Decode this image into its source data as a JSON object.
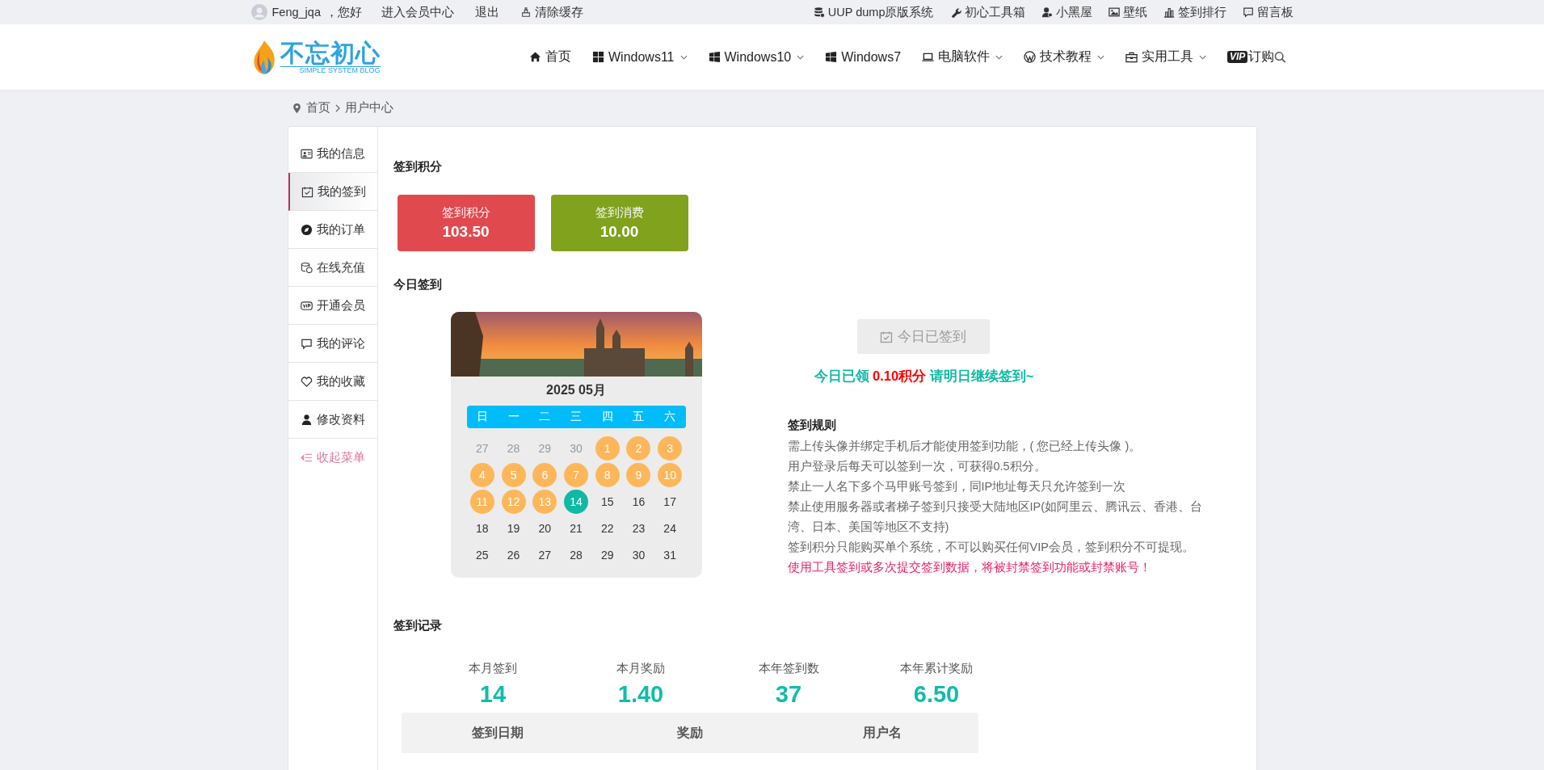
{
  "top_bar": {
    "user": {
      "name": "Feng_jqa",
      "greeting": "，您好"
    },
    "left_links": [
      "进入会员中心",
      "退出",
      "清除缓存"
    ],
    "right_links": [
      "UUP dump原版系统",
      "初心工具箱",
      "小黑屋",
      "壁纸",
      "签到排行",
      "留言板"
    ]
  },
  "header": {
    "logo": {
      "title": "不忘初心",
      "subtitle": "SIMPLE SYSTEM BLOG"
    },
    "nav": [
      {
        "label": "首页",
        "has_menu": false
      },
      {
        "label": "Windows11",
        "has_menu": true
      },
      {
        "label": "Windows10",
        "has_menu": true
      },
      {
        "label": "Windows7",
        "has_menu": false
      },
      {
        "label": "电脑软件",
        "has_menu": true
      },
      {
        "label": "技术教程",
        "has_menu": true
      },
      {
        "label": "实用工具",
        "has_menu": true
      },
      {
        "label": "订购",
        "has_menu": false
      }
    ],
    "vip_badge": "VIP"
  },
  "breadcrumb": [
    "首页",
    "用户中心"
  ],
  "sidebar": {
    "items": [
      {
        "label": "我的信息",
        "selected": false
      },
      {
        "label": "我的签到",
        "selected": true
      },
      {
        "label": "我的订单",
        "selected": false
      },
      {
        "label": "在线充值",
        "selected": false
      },
      {
        "label": "开通会员",
        "selected": false
      },
      {
        "label": "我的评论",
        "selected": false
      },
      {
        "label": "我的收藏",
        "selected": false
      },
      {
        "label": "修改资料",
        "selected": false
      }
    ],
    "collapse": "收起菜单"
  },
  "points": {
    "title": "签到积分",
    "cards": [
      {
        "label": "签到积分",
        "value": "103.50",
        "color": "#e04a4f"
      },
      {
        "label": "签到消费",
        "value": "10.00",
        "color": "#80a21d"
      }
    ]
  },
  "today": {
    "title": "今日签到",
    "calendar": {
      "month": "2025 05月",
      "weekdays": [
        "日",
        "一",
        "二",
        "三",
        "四",
        "五",
        "六"
      ],
      "days": [
        {
          "day": "27",
          "kind": "other"
        },
        {
          "day": "28",
          "kind": "other"
        },
        {
          "day": "29",
          "kind": "other"
        },
        {
          "day": "30",
          "kind": "other"
        },
        {
          "day": "1",
          "kind": "signed"
        },
        {
          "day": "2",
          "kind": "signed"
        },
        {
          "day": "3",
          "kind": "signed"
        },
        {
          "day": "4",
          "kind": "signed"
        },
        {
          "day": "5",
          "kind": "signed"
        },
        {
          "day": "6",
          "kind": "signed"
        },
        {
          "day": "7",
          "kind": "signed"
        },
        {
          "day": "8",
          "kind": "signed"
        },
        {
          "day": "9",
          "kind": "signed"
        },
        {
          "day": "10",
          "kind": "signed"
        },
        {
          "day": "11",
          "kind": "signed"
        },
        {
          "day": "12",
          "kind": "signed"
        },
        {
          "day": "13",
          "kind": "signed"
        },
        {
          "day": "14",
          "kind": "today"
        },
        {
          "day": "15",
          "kind": "normal"
        },
        {
          "day": "16",
          "kind": "normal"
        },
        {
          "day": "17",
          "kind": "normal"
        },
        {
          "day": "18",
          "kind": "normal"
        },
        {
          "day": "19",
          "kind": "normal"
        },
        {
          "day": "20",
          "kind": "normal"
        },
        {
          "day": "21",
          "kind": "normal"
        },
        {
          "day": "22",
          "kind": "normal"
        },
        {
          "day": "23",
          "kind": "normal"
        },
        {
          "day": "24",
          "kind": "normal"
        },
        {
          "day": "25",
          "kind": "normal"
        },
        {
          "day": "26",
          "kind": "normal"
        },
        {
          "day": "27",
          "kind": "normal"
        },
        {
          "day": "28",
          "kind": "normal"
        },
        {
          "day": "29",
          "kind": "normal"
        },
        {
          "day": "30",
          "kind": "normal"
        },
        {
          "day": "31",
          "kind": "normal"
        }
      ]
    },
    "button": {
      "label": "今日已签到",
      "disabled": true
    },
    "message": {
      "before": "今日已领 ",
      "amount": "0.10积分",
      "after": " 请明日继续签到~"
    },
    "rules": {
      "title": "签到规则",
      "lines": [
        {
          "text": "需上传头像并绑定手机后才能使用签到功能，( 您已经上传头像 )。",
          "kind": "rule"
        },
        {
          "text": "用户登录后每天可以签到一次，可获得0.5积分。",
          "kind": "rule"
        },
        {
          "text": "禁止一人名下多个马甲账号签到，同IP地址每天只允许签到一次",
          "kind": "rule"
        },
        {
          "text": "禁止使用服务器或者梯子签到只接受大陆地区IP(如阿里云、腾讯云、香港、台湾、日本、美国等地区不支持)",
          "kind": "rule"
        },
        {
          "text": "签到积分只能购买单个系统，不可以购买任何VIP会员，签到积分不可提现。",
          "kind": "rule"
        },
        {
          "text": "使用工具签到或多次提交签到数据，将被封禁签到功能或封禁账号！",
          "kind": "warning"
        }
      ]
    }
  },
  "records": {
    "title": "签到记录",
    "stats": [
      {
        "label": "本月签到",
        "value": "14"
      },
      {
        "label": "本月奖励",
        "value": "1.40"
      },
      {
        "label": "本年签到数",
        "value": "37"
      },
      {
        "label": "本年累计奖励",
        "value": "6.50"
      }
    ],
    "table": {
      "columns": [
        "签到日期",
        "奖励",
        "用户名"
      ]
    }
  }
}
